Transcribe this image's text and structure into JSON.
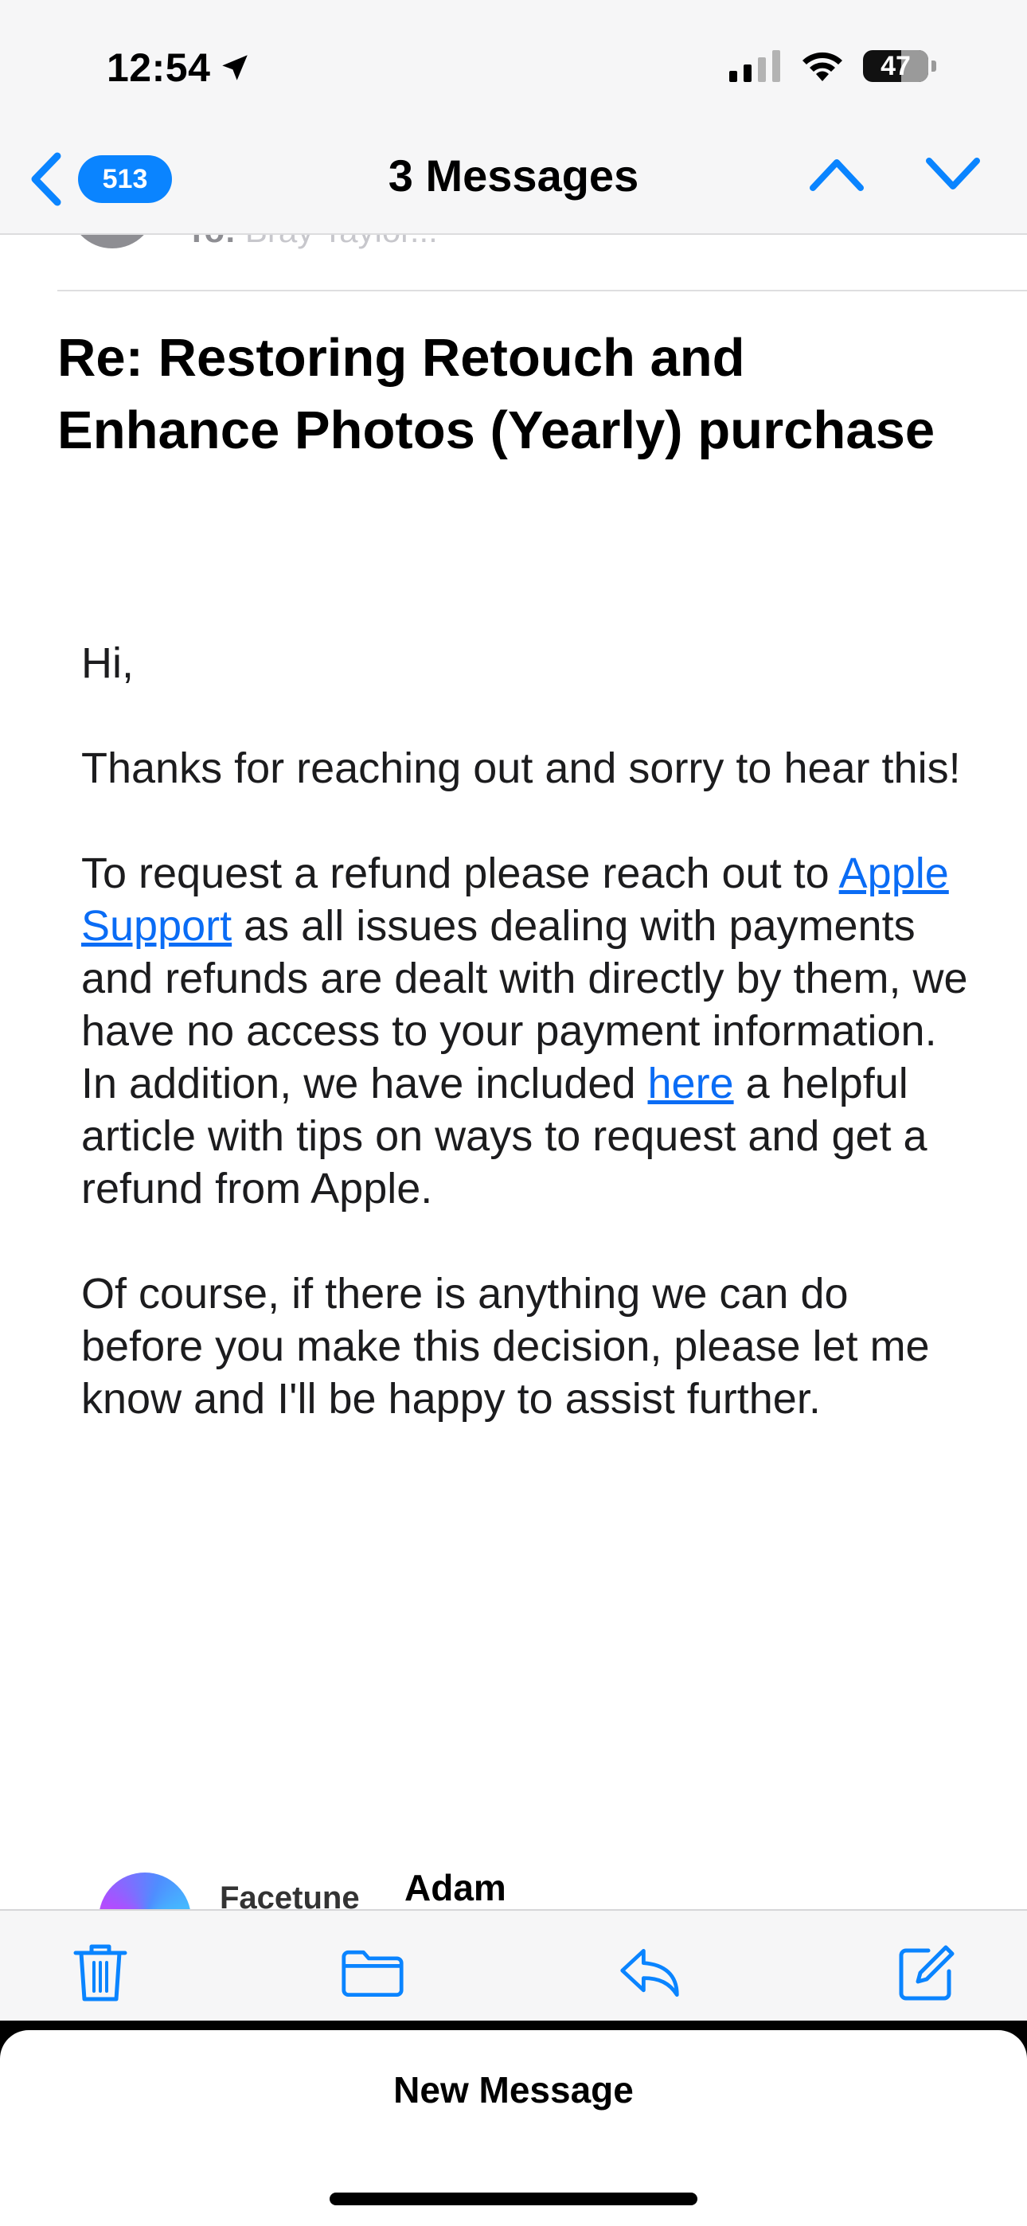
{
  "status_bar": {
    "time": "12:54",
    "battery": "47"
  },
  "nav": {
    "unread_count": "513",
    "title": "3 Messages"
  },
  "previous_message": {
    "to_label": "To:",
    "to_name": "Bray Taylor..."
  },
  "email": {
    "subject": "Re: Restoring Retouch and Enhance Photos (Yearly) purchase",
    "greeting": "Hi,",
    "para1": "Thanks for reaching out and sorry to hear this!",
    "para2_start": "To request a refund please reach out to ",
    "para2_link1": "Apple Support",
    "para2_mid": " as all issues dealing with payments and refunds are dealt with directly by them, we have no access to your payment information. In addition, we have included ",
    "para2_link2": "here",
    "para2_end": " a helpful article with tips on ways to request and get a refund from Apple.",
    "para3": "Of course, if there is anything we can do before you make this decision, please let me know and I'll be happy to assist further."
  },
  "signature": {
    "org": "Facetune",
    "name": "Adam"
  },
  "draft": {
    "title": "New Message"
  },
  "colors": {
    "accent": "#0a84ff",
    "link": "#0a6cf5"
  }
}
